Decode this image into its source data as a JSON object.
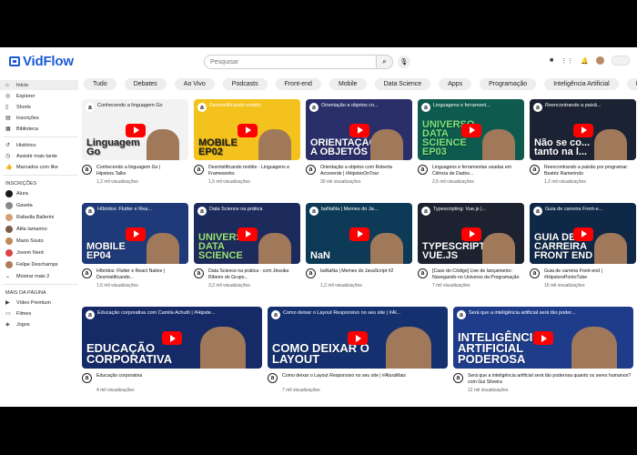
{
  "app": {
    "name": "VidFlow"
  },
  "search": {
    "placeholder": "Pesquisar"
  },
  "chips": [
    "Tudo",
    "Debates",
    "Ao Vivo",
    "Podcasts",
    "Front-end",
    "Mobile",
    "Data Science",
    "Apps",
    "Programação",
    "Inteligência Artificial",
    "Inovação"
  ],
  "sidebar": {
    "main": [
      {
        "label": "Início",
        "icon": "home-icon",
        "glyph": "⌂",
        "active": true
      },
      {
        "label": "Explorer",
        "icon": "compass-icon",
        "glyph": "◎"
      },
      {
        "label": "Shorts",
        "icon": "shorts-icon",
        "glyph": "▯"
      },
      {
        "label": "Inscrições",
        "icon": "subscriptions-icon",
        "glyph": "▤"
      },
      {
        "label": "Biblioteca",
        "icon": "library-icon",
        "glyph": "▦"
      }
    ],
    "secondary": [
      {
        "label": "Histórico",
        "icon": "history-icon",
        "glyph": "↺"
      },
      {
        "label": "Assistir mais tarde",
        "icon": "clock-icon",
        "glyph": "◷"
      },
      {
        "label": "Marcados com like",
        "icon": "thumbs-up-icon",
        "glyph": "👍"
      }
    ],
    "subscriptions_title": "INSCRIÇÕES",
    "subscriptions": [
      "Alura",
      "Gaveta",
      "Rafaella Ballerini",
      "Átila Iamarino",
      "Mario Souto",
      "Jovem Nerd",
      "Felipe Deschamps"
    ],
    "show_more": "Mostrar mais 2",
    "more_title": "MAIS DA PÁGINA",
    "more": [
      {
        "label": "Vídeo Premium",
        "icon": "premium-icon",
        "glyph": "▶"
      },
      {
        "label": "Filmes",
        "icon": "film-icon",
        "glyph": "▭"
      },
      {
        "label": "Jogos",
        "icon": "games-icon",
        "glyph": "◈"
      }
    ]
  },
  "rows": [
    [
      {
        "thumb_title": "Conhecendo a linguagem Go",
        "art": "Linguagem Go",
        "bg": "#f2f2f2",
        "fg": "#222",
        "title": "Conhecendo a linguagem Go | Hipsters.Talks",
        "views": "1,2 mil visualizações"
      },
      {
        "thumb_title": "Desmistificando mobile",
        "art": "MOBILE EP02",
        "bg": "#f4c21c",
        "fg": "#1a1a1a",
        "title": "Desmistificando mobile - Linguagens e Frameworks",
        "views": "1,5 mil visualizações"
      },
      {
        "thumb_title": "Orientação a objetos co...",
        "art": "ORIENTAÇÃO A OBJETOS",
        "bg": "#2a2f6a",
        "fg": "#fff",
        "title": "Orientação a objetos com Roberta Arcoverde | #HipsterOnTour",
        "views": "30 mil visualizações"
      },
      {
        "thumb_title": "Linguagens e ferrament...",
        "art": "UNIVERSO DATA SCIENCE EP03",
        "bg": "#0e5a4e",
        "fg": "#7fe07a",
        "title": "Linguagens e ferramentas usadas em Ciência de Dados...",
        "views": "2,5 mil visualizações"
      },
      {
        "thumb_title": "Reencontrando a paixã...",
        "art": "Não se co... tanto na l...",
        "bg": "#1b2233",
        "fg": "#fff",
        "title": "Reencontrando a paixão por programar: Beatriz Ramerindo",
        "views": "1,2 mil visualizações"
      }
    ],
    [
      {
        "thumb_title": "Híbridos: Flutter e Rea...",
        "art": "MOBILE EP04",
        "bg": "#1f3a78",
        "fg": "#fff",
        "title": "Híbridos: Flutter e React Native | Desmistificando...",
        "views": "1,6 mil visualizações"
      },
      {
        "thumb_title": "Data Science na prática",
        "art": "UNIVERSO DATA SCIENCE",
        "bg": "#1d2b5c",
        "fg": "#9be37a",
        "title": "Data Science na prática - com Jéssika Ribeiro do Grupo...",
        "views": "3,2 mil visualizações"
      },
      {
        "thumb_title": "baNaNa | Memes do Ja...",
        "art": "NaN",
        "bg": "#0d3b57",
        "fg": "#fff",
        "title": "baNaNa | Memes do JavaScript #2",
        "views": "1,2 mil visualizações"
      },
      {
        "thumb_title": "Typescripting: Vue.js |...",
        "art": "TYPESCRIPT VUE.JS",
        "bg": "#1c2230",
        "fg": "#fff",
        "title": "[Caso do Código] Live de lançamento: Navegando no Universo da Programação",
        "views": "7 mil visualizações"
      },
      {
        "thumb_title": "Guia de carreira Front-e...",
        "art": "GUIA DE CARREIRA FRONT END",
        "bg": "#102848",
        "fg": "#fff",
        "title": "Guia de carreira Front-end | #HipstersPontoTube",
        "views": "16 mil visualizações"
      }
    ],
    [
      {
        "thumb_title": "Educação corporativa com Camila Achutti | #Hipste...",
        "art": "EDUCAÇÃO CORPORATIVA",
        "bg": "#152a66",
        "fg": "#fff",
        "title": "Educação corporativa",
        "views": "4 mil visualizações"
      },
      {
        "thumb_title": "Como deixar o Layout Responsivo no seu site | #Al...",
        "art": "COMO DEIXAR O LAYOUT",
        "bg": "#14306e",
        "fg": "#fff",
        "title": "Como deixar o Layout Responsivo no seu site | #AluraMais",
        "views": "7 mil visualizações"
      },
      {
        "thumb_title": "Será que a inteligência artificial será tão poder...",
        "art": "INTELIGÊNCIA ARTIFICIAL PODEROSA",
        "bg": "#1e3c8a",
        "fg": "#fff",
        "title": "Será que a inteligência artificial será tão poderosa quanto os seres humanos? com Gui Silveira",
        "views": "12 mil visualizações"
      }
    ]
  ]
}
